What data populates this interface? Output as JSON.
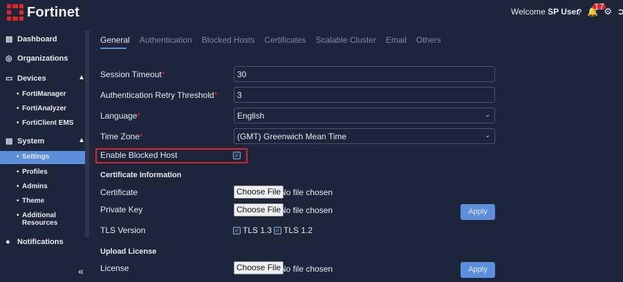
{
  "brand": {
    "name": "Fortinet"
  },
  "header": {
    "welcome_prefix": "Welcome",
    "user": "SP User",
    "notifications_count": "17"
  },
  "sidebar": {
    "items": [
      {
        "label": "Dashboard"
      },
      {
        "label": "Organizations"
      },
      {
        "label": "Devices"
      },
      {
        "label": "System"
      },
      {
        "label": "Notifications"
      }
    ],
    "devices_sub": [
      "FortiManager",
      "FortiAnalyzer",
      "FortiClient EMS"
    ],
    "system_sub": [
      "Settings",
      "Profiles",
      "Admins",
      "Theme",
      "Additional",
      "Resources"
    ]
  },
  "tabs": [
    "General",
    "Authentication",
    "Blocked Hosts",
    "Certificates",
    "Scalable Cluster",
    "Email",
    "Others"
  ],
  "form": {
    "session_timeout": {
      "label": "Session Timeout",
      "value": "30"
    },
    "auth_retry": {
      "label": "Authentication Retry Threshold",
      "value": "3"
    },
    "language": {
      "label": "Language",
      "value": "English"
    },
    "timezone": {
      "label": "Time Zone",
      "value": "(GMT) Greenwich Mean Time"
    },
    "blocked_host": {
      "label": "Enable Blocked Host",
      "checked": true
    }
  },
  "certificate": {
    "section_title": "Certificate Information",
    "certificate_label": "Certificate",
    "private_key_label": "Private Key",
    "tls_label": "TLS Version",
    "tls13": "TLS 1.3",
    "tls12": "TLS 1.2",
    "file_button": "Choose File",
    "file_status": "No file chosen",
    "apply_label": "Apply"
  },
  "license": {
    "section_title": "Upload License",
    "license_label": "License",
    "file_button": "Choose File",
    "file_status": "No file chosen",
    "apply_label": "Apply"
  },
  "colors": {
    "accent": "#5b8fdb",
    "brand_red": "#e0262c",
    "background": "#1c2539"
  }
}
